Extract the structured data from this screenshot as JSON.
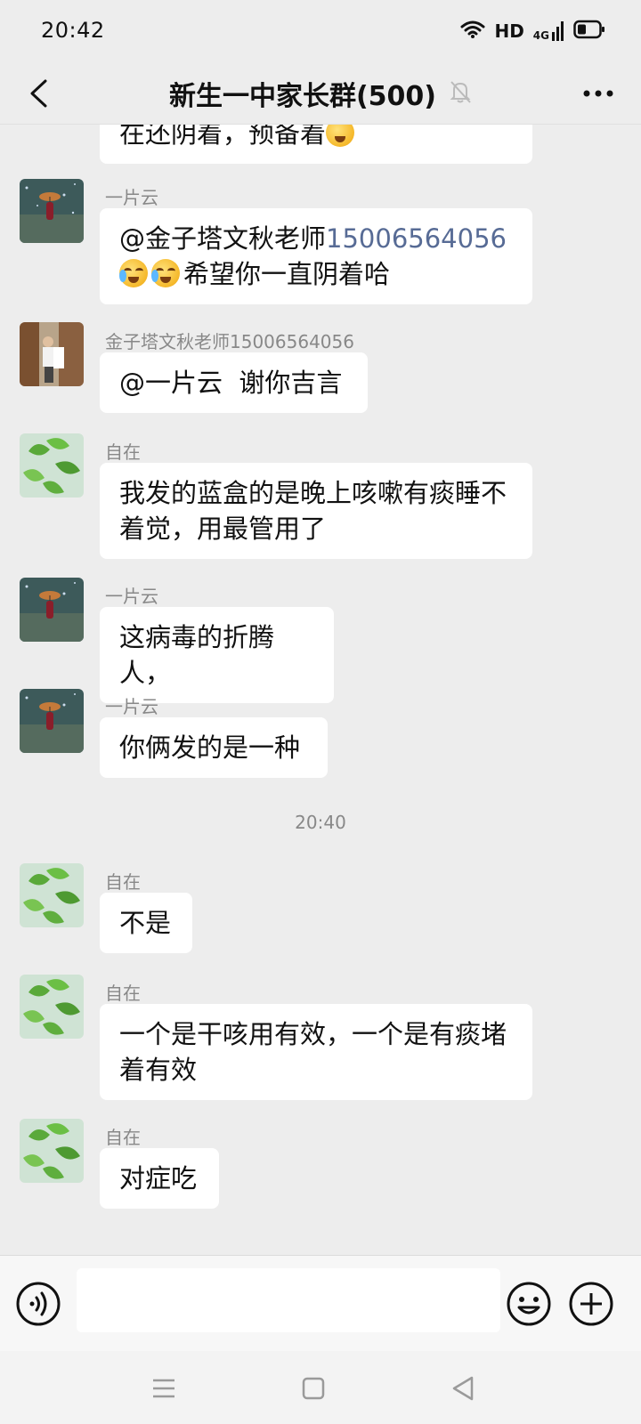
{
  "status_bar": {
    "time": "20:42",
    "hd_label": "HD",
    "network_label": "4G"
  },
  "header": {
    "title": "新生一中家长群(500)"
  },
  "messages": [
    {
      "partial_text": "在还阴着，预备着"
    },
    {
      "sender": "一片云",
      "mention": "@金子塔文秋老师",
      "phone": "15006564056",
      "text": "希望你一直阴着哈"
    },
    {
      "sender": "金子塔文秋老师15006564056",
      "text": "@一片云  谢你吉言"
    },
    {
      "sender": "自在",
      "line1": "我发的蓝盒的是晚上咳嗽有痰睡不",
      "line2": "着觉，用最管用了"
    },
    {
      "sender": "一片云",
      "text": "这病毒的折腾人，"
    },
    {
      "sender": "一片云",
      "text": "你俩发的是一种"
    },
    {
      "sender": "自在",
      "text": "不是"
    },
    {
      "sender": "自在",
      "line1": "一个是干咳用有效，一个是有痰堵",
      "line2": "着有效"
    },
    {
      "sender": "自在",
      "text": "对症吃"
    }
  ],
  "time_divider": "20:40",
  "input": {
    "placeholder": ""
  },
  "colors": {
    "background": "#ededed",
    "bubble": "#ffffff",
    "link": "#576b95",
    "sender": "#888888"
  },
  "icons": [
    "back-icon",
    "mute-icon",
    "more-icon",
    "voice-icon",
    "emoji-icon",
    "add-icon",
    "menu-nav-icon",
    "home-nav-icon",
    "back-nav-icon"
  ]
}
